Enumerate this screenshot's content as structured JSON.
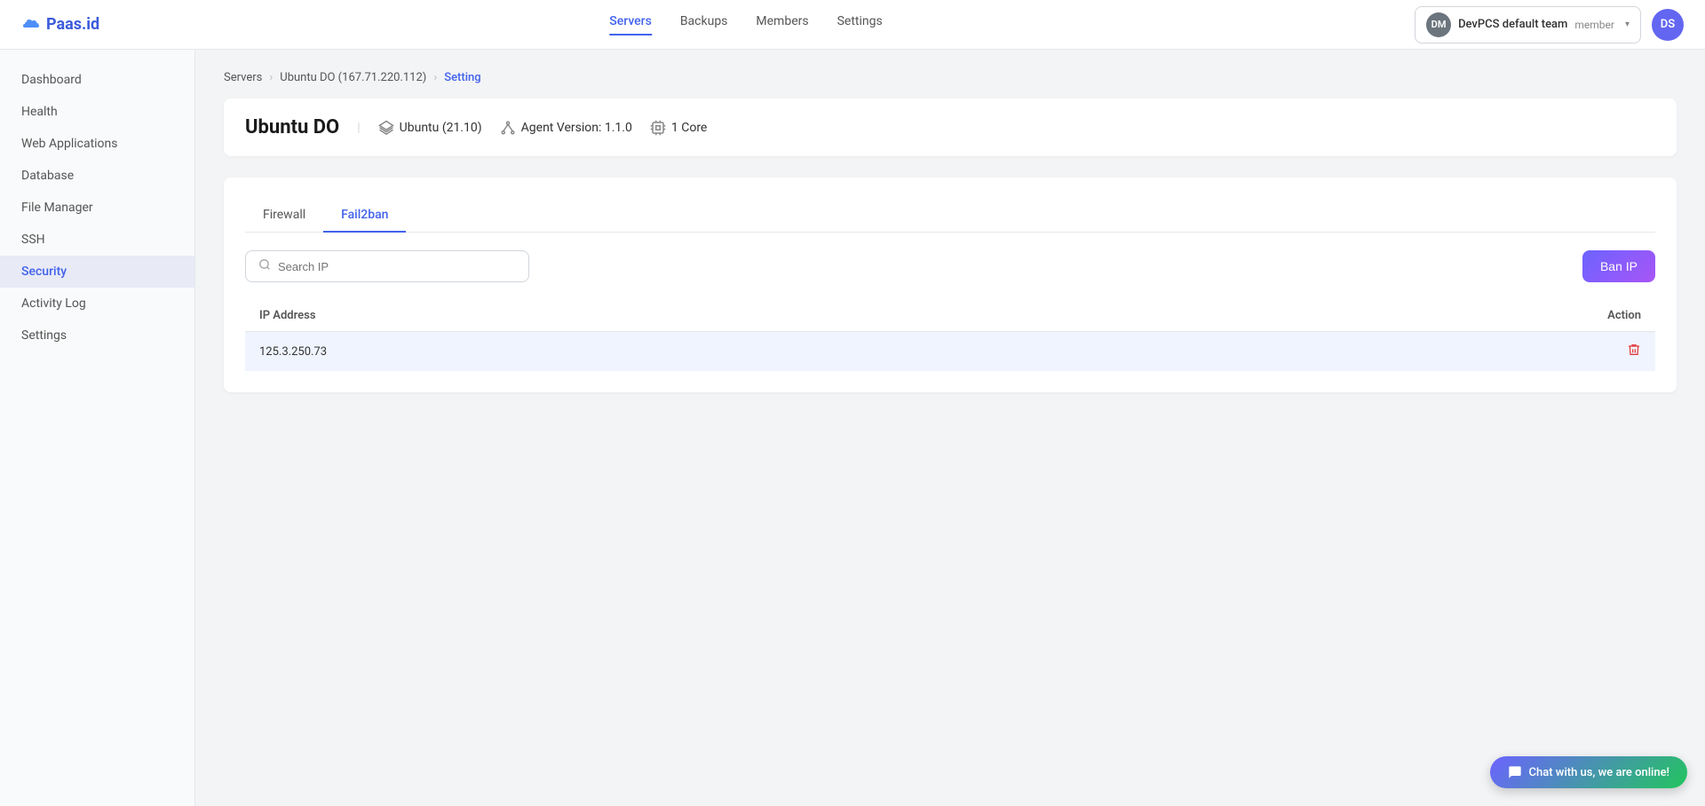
{
  "logo": {
    "text": "Paas.id"
  },
  "topnav": {
    "links": [
      {
        "label": "Servers",
        "active": true
      },
      {
        "label": "Backups",
        "active": false
      },
      {
        "label": "Members",
        "active": false
      },
      {
        "label": "Settings",
        "active": false
      }
    ],
    "team": {
      "initials": "DM",
      "name": "DevPCS default team",
      "role": "member"
    },
    "user": {
      "initials": "DS"
    }
  },
  "breadcrumb": {
    "servers": "Servers",
    "server": "Ubuntu DO (167.71.220.112)",
    "current": "Setting"
  },
  "server": {
    "name": "Ubuntu DO",
    "os": "Ubuntu (21.10)",
    "agent_label": "Agent Version:",
    "agent_version": "1.1.0",
    "cpu_label": "1 Core"
  },
  "sidebar": {
    "items": [
      {
        "label": "Dashboard",
        "active": false,
        "id": "dashboard"
      },
      {
        "label": "Health",
        "active": false,
        "id": "health"
      },
      {
        "label": "Web Applications",
        "active": false,
        "id": "web-applications"
      },
      {
        "label": "Database",
        "active": false,
        "id": "database"
      },
      {
        "label": "File Manager",
        "active": false,
        "id": "file-manager"
      },
      {
        "label": "SSH",
        "active": false,
        "id": "ssh"
      },
      {
        "label": "Security",
        "active": true,
        "id": "security"
      },
      {
        "label": "Activity Log",
        "active": false,
        "id": "activity-log"
      },
      {
        "label": "Settings",
        "active": false,
        "id": "settings"
      }
    ]
  },
  "tabs": [
    {
      "label": "Firewall",
      "active": false
    },
    {
      "label": "Fail2ban",
      "active": true
    }
  ],
  "search": {
    "placeholder": "Search IP"
  },
  "ban_ip_button": "Ban IP",
  "table": {
    "columns": [
      {
        "label": "IP Address"
      },
      {
        "label": "Action"
      }
    ],
    "rows": [
      {
        "ip": "125.3.250.73"
      }
    ]
  },
  "chat_widget": {
    "label": "Chat with us, we are online!"
  }
}
